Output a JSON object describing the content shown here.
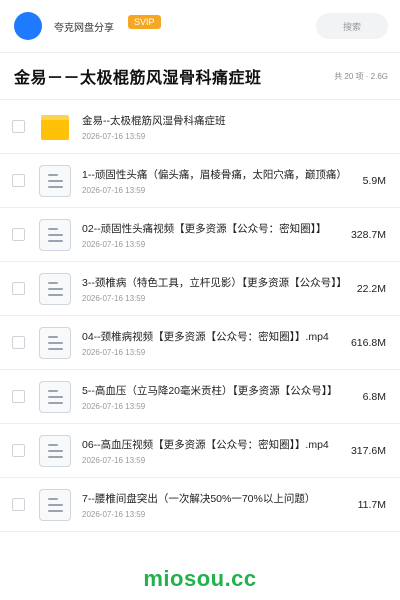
{
  "header": {
    "share_name": "夸克网盘分享",
    "badge": "SVIP",
    "search_placeholder": "搜索",
    "avatar_color": "#1e7bff",
    "badge_color": "#f5a623"
  },
  "title_bar": {
    "title": "金易－－太极棍筋风湿骨科痛症班",
    "meta": "共 20 项 · 2.6G"
  },
  "files": [
    {
      "icon": "folder-icon",
      "name": "金易--太极棍筋风湿骨科痛症班",
      "date": "2026-07-16 13:59",
      "size": ""
    },
    {
      "icon": "document-icon",
      "name": "1--顽固性头痛（偏头痛，眉棱骨痛，太阳穴痛，巅顶痛）",
      "date": "2026-07-16 13:59",
      "size": "5.9M"
    },
    {
      "icon": "document-icon",
      "name": "02--顽固性头痛视频【更多资源【公众号：密知圈】】",
      "date": "2026-07-16 13:59",
      "size": "328.7M"
    },
    {
      "icon": "document-icon",
      "name": "3--颈椎病（特色工具，立杆见影）【更多资源【公众号】】",
      "date": "2026-07-16 13:59",
      "size": "22.2M"
    },
    {
      "icon": "document-icon",
      "name": "04--颈椎病视频【更多资源【公众号：密知圈】】.mp4",
      "date": "2026-07-16 13:59",
      "size": "616.8M"
    },
    {
      "icon": "document-icon",
      "name": "5--高血压（立马降20毫米贡柱）【更多资源【公众号】】",
      "date": "2026-07-16 13:59",
      "size": "6.8M"
    },
    {
      "icon": "document-icon",
      "name": "06--高血压视频【更多资源【公众号：密知圈】】.mp4",
      "date": "2026-07-16 13:59",
      "size": "317.6M"
    },
    {
      "icon": "document-icon",
      "name": "7--腰椎间盘突出（一次解决50%一70%以上问题）",
      "date": "2026-07-16 13:59",
      "size": "11.7M"
    }
  ],
  "watermark": {
    "text": "miosou.cc",
    "color": "#22b14c"
  }
}
